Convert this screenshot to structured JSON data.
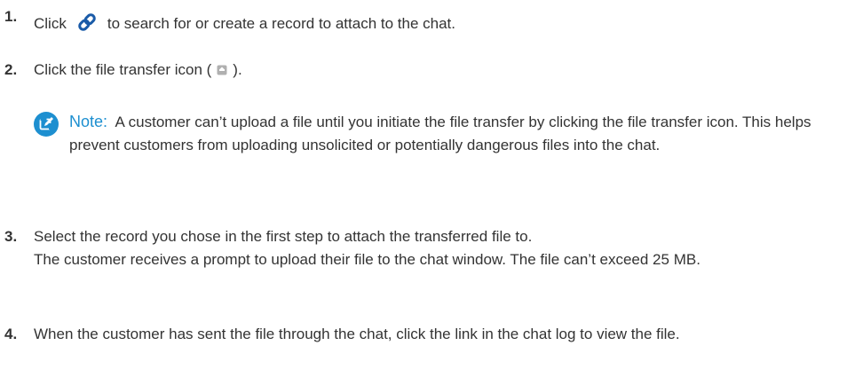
{
  "steps": [
    {
      "number": "1.",
      "before_icon": "Click",
      "icon": "link-icon",
      "after_icon": "to search for or create a record to attach to the chat."
    },
    {
      "number": "2.",
      "before_icon": "Click the file transfer icon (",
      "icon": "file-transfer-icon",
      "after_icon": ")."
    },
    {
      "number": "3.",
      "text": "Select the record you chose in the first step to attach the transferred file to.",
      "detail": "The customer receives a prompt to upload their file to the chat window. The file can’t exceed 25 MB."
    },
    {
      "number": "4.",
      "text": "When the customer has sent the file through the chat, click the link in the chat log to view the file."
    }
  ],
  "note": {
    "icon": "note-edit-icon",
    "label": "Note:",
    "text": "A customer can’t upload a file until you initiate the file transfer by clicking the file transfer icon. This helps prevent customers from uploading unsolicited or potentially dangerous files into the chat."
  },
  "colors": {
    "text": "#333333",
    "accent": "#1d8fd0",
    "link_icon": "#1a5ba8",
    "file_icon": "#b0b0b0"
  }
}
